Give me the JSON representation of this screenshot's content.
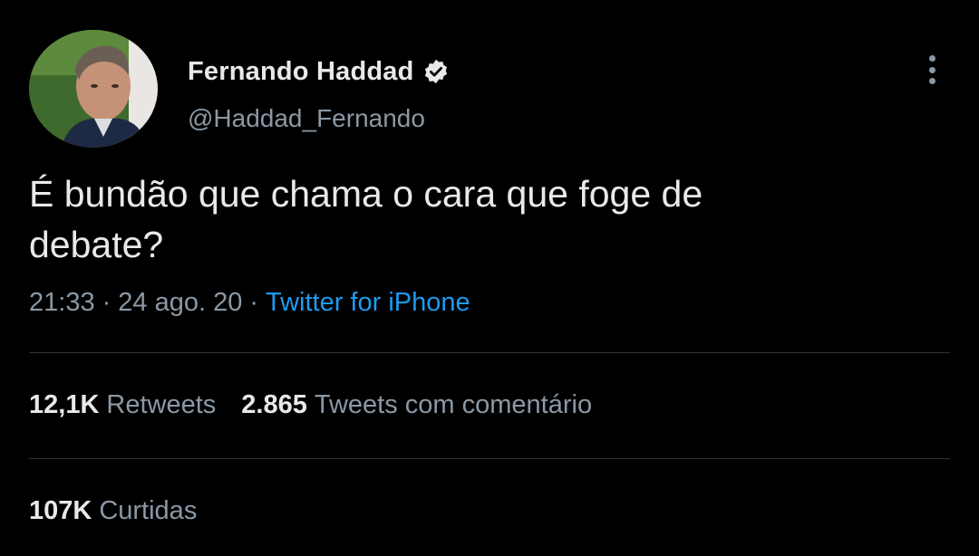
{
  "author": {
    "display_name": "Fernando Haddad",
    "handle": "@Haddad_Fernando",
    "verified": true
  },
  "tweet": {
    "text_line1": "É bundão que chama o cara que foge de",
    "text_line2": "debate?",
    "time": "21:33",
    "date": "24 ago. 20",
    "separator": "·",
    "source": "Twitter for iPhone"
  },
  "stats": {
    "retweets_count": "12,1K",
    "retweets_label": "Retweets",
    "quotes_count": "2.865",
    "quotes_label": "Tweets com comentário",
    "likes_count": "107K",
    "likes_label": "Curtidas"
  },
  "icons": {
    "verified": "verified-badge-icon",
    "more": "more-options-icon"
  },
  "colors": {
    "background": "#000000",
    "primary_text": "#e7e9ea",
    "secondary_text": "#8b98a5",
    "link": "#1d9bf0",
    "divider": "#2f3336"
  }
}
